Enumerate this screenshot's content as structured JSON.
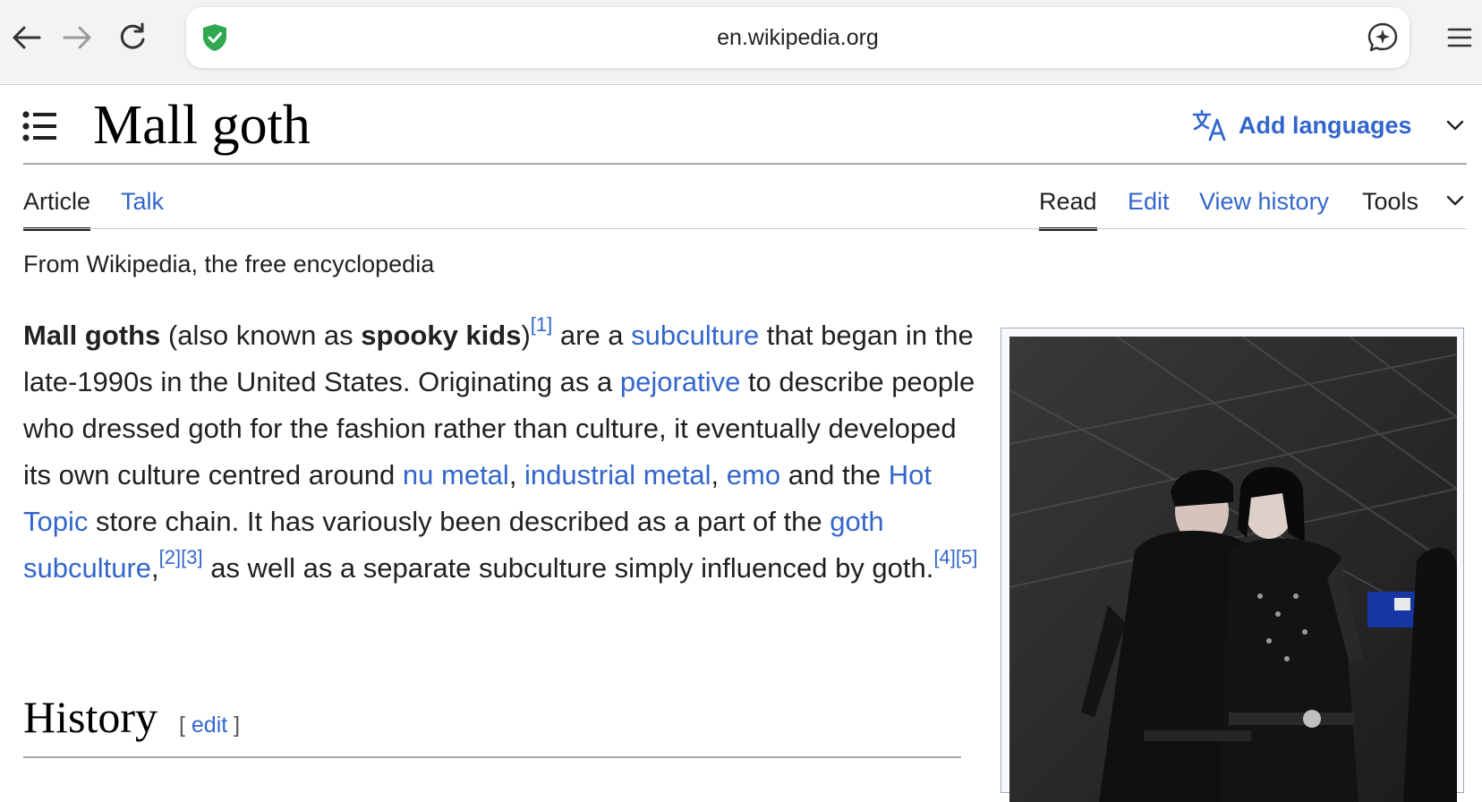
{
  "browser": {
    "url": "en.wikipedia.org",
    "icons": [
      "back-arrow-icon",
      "forward-arrow-icon",
      "reload-icon",
      "shield-check-icon",
      "ai-sparkle-icon",
      "hamburger-menu-icon"
    ]
  },
  "header": {
    "title": "Mall goth",
    "add_languages": "Add languages"
  },
  "tabs": {
    "article": "Article",
    "talk": "Talk",
    "read": "Read",
    "edit": "Edit",
    "view_history": "View history",
    "tools": "Tools"
  },
  "tagline": "From Wikipedia, the free encyclopedia",
  "lead": {
    "t1": "Mall goths",
    "t2": " (also known as ",
    "t3": "spooky kids",
    "t4": ")",
    "ref1": "[1]",
    "t5": " are a ",
    "link_subculture": "subculture",
    "t6": " that began in the late-1990s in the United States. Originating as a ",
    "link_pejorative": "pejorative",
    "t7": " to describe people who dressed goth for the fashion rather than culture, it eventually developed its own culture centred around ",
    "link_nu_metal": "nu metal",
    "t8": ", ",
    "link_industrial_metal": "industrial metal",
    "t9": ", ",
    "link_emo": "emo",
    "t10": " and the ",
    "link_hot_topic": "Hot Topic",
    "t11": " store chain. It has variously been described as a part of the ",
    "link_goth_subculture": "goth subculture",
    "t12": ",",
    "ref2": "[2]",
    "ref3": "[3]",
    "t13": " as well as a separate subculture simply influenced by goth.",
    "ref4": "[4]",
    "ref5": "[5]"
  },
  "history": {
    "title": "History",
    "edit_open": "[ ",
    "edit_label": "edit",
    "edit_close": " ]"
  },
  "colors": {
    "link": "#3366cc",
    "text": "#202122",
    "shield": "#2fa84f"
  }
}
